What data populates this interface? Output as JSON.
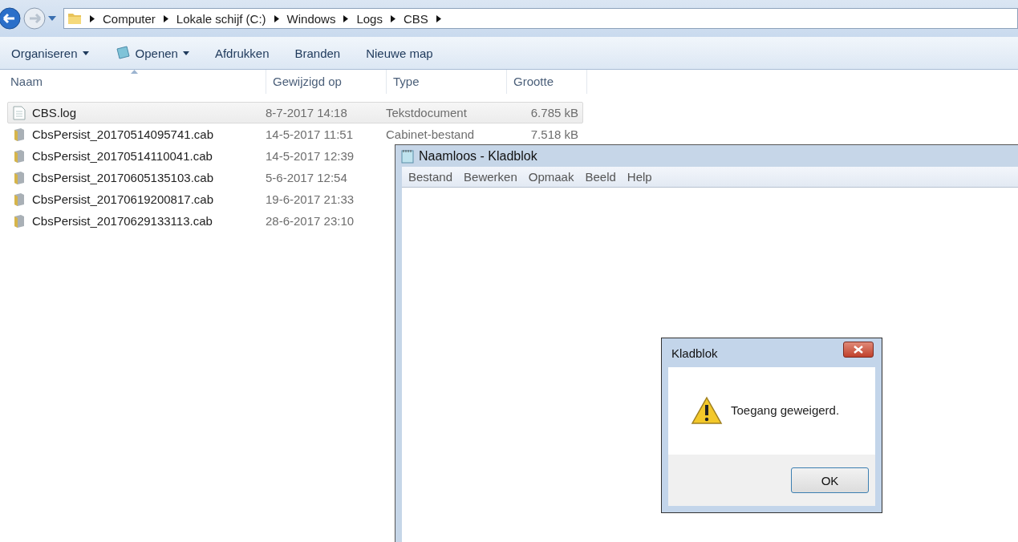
{
  "explorer": {
    "breadcrumb": [
      "Computer",
      "Lokale schijf (C:)",
      "Windows",
      "Logs",
      "CBS"
    ],
    "toolbar": [
      {
        "label": "Organiseren",
        "dropdown": true,
        "icon": false
      },
      {
        "label": "Openen",
        "dropdown": true,
        "icon": true
      },
      {
        "label": "Afdrukken",
        "dropdown": false,
        "icon": false
      },
      {
        "label": "Branden",
        "dropdown": false,
        "icon": false
      },
      {
        "label": "Nieuwe map",
        "dropdown": false,
        "icon": false
      }
    ],
    "columns": [
      "Naam",
      "Gewijzigd op",
      "Type",
      "Grootte"
    ],
    "files": [
      {
        "kind": "text",
        "name": "CBS.log",
        "modified": "8-7-2017 14:18",
        "type": "Tekstdocument",
        "size": "6.785 kB",
        "selected": true
      },
      {
        "kind": "cabinet",
        "name": "CbsPersist_20170514095741.cab",
        "modified": "14-5-2017 11:51",
        "type": "Cabinet-bestand",
        "size": "7.518 kB",
        "selected": false
      },
      {
        "kind": "cabinet",
        "name": "CbsPersist_20170514110041.cab",
        "modified": "14-5-2017 12:39",
        "selected": false
      },
      {
        "kind": "cabinet",
        "name": "CbsPersist_20170605135103.cab",
        "modified": "5-6-2017 12:54",
        "selected": false
      },
      {
        "kind": "cabinet",
        "name": "CbsPersist_20170619200817.cab",
        "modified": "19-6-2017 21:33",
        "selected": false
      },
      {
        "kind": "cabinet",
        "name": "CbsPersist_20170629133113.cab",
        "modified": "28-6-2017 23:10",
        "selected": false
      }
    ]
  },
  "notepad": {
    "title": "Naamloos - Kladblok",
    "menu": [
      "Bestand",
      "Bewerken",
      "Opmaak",
      "Beeld",
      "Help"
    ]
  },
  "dialog": {
    "title": "Kladblok",
    "message": "Toegang geweigerd.",
    "button": "OK"
  }
}
